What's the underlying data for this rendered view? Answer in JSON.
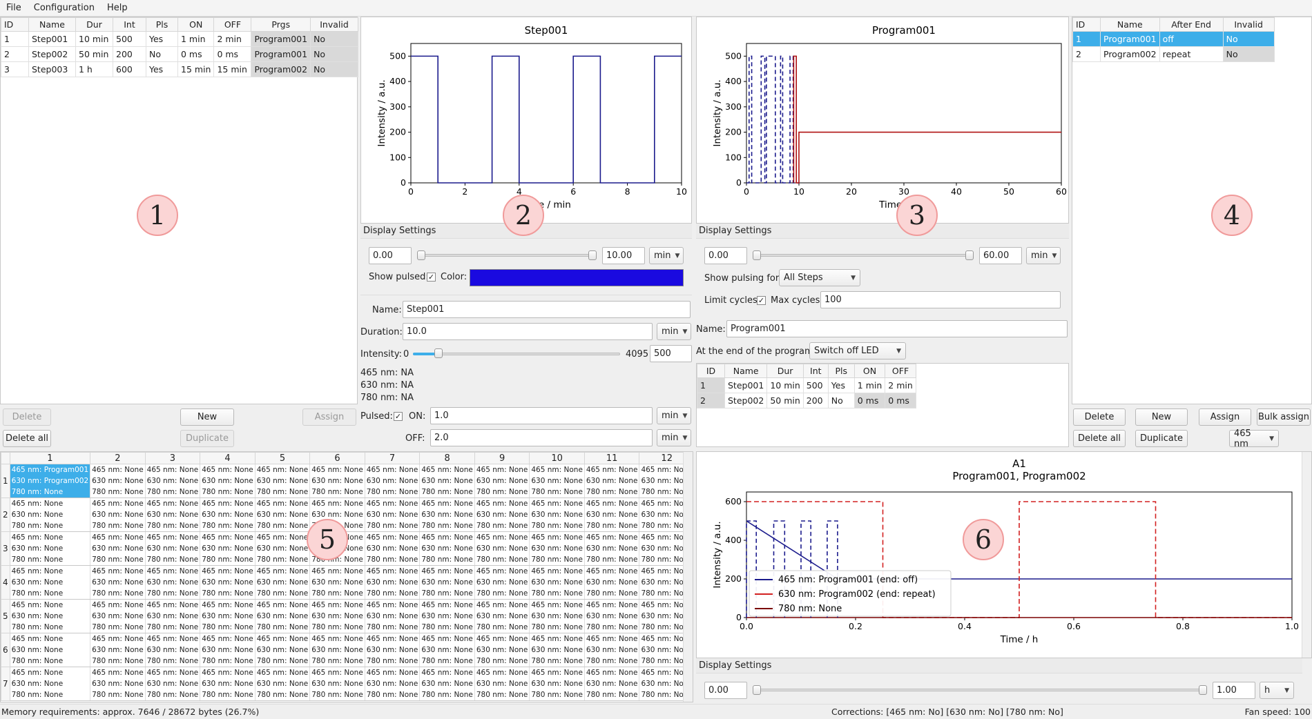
{
  "menu": [
    "File",
    "Configuration",
    "Help"
  ],
  "steps_table": {
    "headers": [
      "ID",
      "Name",
      "Dur",
      "Int",
      "Pls",
      "ON",
      "OFF",
      "Prgs",
      "Invalid"
    ],
    "rows": [
      [
        "1",
        "Step001",
        "10 min",
        "500",
        "Yes",
        "1 min",
        "2 min",
        "Program001",
        "No"
      ],
      [
        "2",
        "Step002",
        "50 min",
        "200",
        "No",
        "0 ms",
        "0 ms",
        "Program001",
        "No"
      ],
      [
        "3",
        "Step003",
        "1 h",
        "600",
        "Yes",
        "15 min",
        "15 min",
        "Program002",
        "No"
      ]
    ],
    "buttons": {
      "delete": "Delete",
      "new": "New",
      "assign": "Assign",
      "delete_all": "Delete all",
      "duplicate": "Duplicate"
    }
  },
  "programs_table": {
    "headers": [
      "ID",
      "Name",
      "After End",
      "Invalid"
    ],
    "rows": [
      [
        "1",
        "Program001",
        "off",
        "No"
      ],
      [
        "2",
        "Program002",
        "repeat",
        "No"
      ]
    ],
    "buttons": {
      "delete": "Delete",
      "new": "New",
      "assign": "Assign",
      "bulk_assign": "Bulk assign",
      "delete_all": "Delete all",
      "duplicate": "Duplicate",
      "wavelength": "465 nm"
    }
  },
  "step_panel": {
    "display_settings": "Display Settings",
    "range_min": "0.00",
    "range_max": "10.00",
    "unit": "min",
    "show_pulsed": "Show pulsed:",
    "color_label": "Color:",
    "color": "#1a0ae0",
    "name_label": "Name:",
    "name": "Step001",
    "duration_label": "Duration:",
    "duration": "10.0",
    "duration_unit": "min",
    "intensity_label": "Intensity:",
    "int_min": "0",
    "int_max": "4095",
    "intensity": "500",
    "intensity_fraction": 0.122,
    "nm465": "465 nm: NA",
    "nm630": "630 nm: NA",
    "nm780": "780 nm: NA",
    "pulsed_label": "Pulsed:",
    "on_label": "ON:",
    "on": "1.0",
    "on_unit": "min",
    "off_label": "OFF:",
    "off": "2.0",
    "off_unit": "min"
  },
  "program_panel": {
    "display_settings": "Display Settings",
    "range_min": "0.00",
    "range_max": "60.00",
    "unit": "min",
    "show_pulsing_label": "Show pulsing for:",
    "show_pulsing": "All Steps",
    "limit_cycles": "Limit cycles:",
    "max_cycles_label": "Max cycles:",
    "max_cycles": "100",
    "name_label": "Name:",
    "name": "Program001",
    "end_label": "At the end of the program:",
    "end_value": "Switch off LED",
    "headers": [
      "ID",
      "Name",
      "Dur",
      "Int",
      "Pls",
      "ON",
      "OFF"
    ],
    "rows": [
      [
        "1",
        "Step001",
        "10 min",
        "500",
        "Yes",
        "1 min",
        "2 min"
      ],
      [
        "2",
        "Step002",
        "50 min",
        "200",
        "No",
        "0 ms",
        "0 ms"
      ]
    ]
  },
  "well_panel": {
    "display_settings": "Display Settings",
    "range_min": "0.00",
    "range_max": "1.00",
    "unit": "h"
  },
  "wells": {
    "columns": [
      "1",
      "2",
      "3",
      "4",
      "5",
      "6",
      "7",
      "8",
      "9",
      "10",
      "11",
      "12"
    ],
    "rows": [
      "1",
      "2",
      "3",
      "4",
      "5",
      "6",
      "7"
    ],
    "selected": [
      "465 nm: Program001",
      "630 nm: Program002",
      "780 nm: None"
    ],
    "default": [
      "465 nm: None",
      "630 nm: None",
      "780 nm: None"
    ]
  },
  "markers": [
    "1",
    "2",
    "3",
    "4",
    "5",
    "6"
  ],
  "status": {
    "memory": "Memory requirements: approx. 7646 / 28672 bytes (26.7%)",
    "corrections": "Corrections: [465 nm: No] [630 nm: No] [780 nm: No]",
    "fan": "Fan speed: 100"
  },
  "chart_data": [
    {
      "type": "line",
      "title": "Step001",
      "xlabel": "Time / min",
      "ylabel": "Intensity / a.u.",
      "xlim": [
        0,
        10
      ],
      "ylim": [
        0,
        550
      ],
      "series": [
        {
          "x": [
            0,
            1,
            1,
            3,
            3,
            4,
            4,
            6,
            6,
            7,
            7,
            9,
            9,
            10
          ],
          "y": [
            500,
            500,
            0,
            0,
            500,
            500,
            0,
            0,
            500,
            500,
            0,
            0,
            500,
            500
          ]
        }
      ]
    },
    {
      "type": "line",
      "title": "Program001",
      "xlabel": "Time / min",
      "ylabel": "Intensity / a.u.",
      "xlim": [
        0,
        60
      ],
      "ylim": [
        0,
        550
      ],
      "series": [
        {
          "style": "dashed",
          "x": [
            0,
            0.5,
            0.5,
            1,
            1,
            2.8,
            2.8,
            3.5,
            3.5,
            3.8,
            3.8,
            5.5,
            5.5,
            6.5,
            6.5,
            6.9,
            6.9,
            8.3,
            8.3,
            8.9,
            8.9,
            10
          ],
          "y": [
            0,
            0,
            500,
            500,
            0,
            0,
            500,
            500,
            0,
            0,
            500,
            500,
            0,
            0,
            500,
            500,
            0,
            0,
            500,
            500,
            0,
            0
          ]
        },
        {
          "x": [
            9,
            9,
            9.5,
            9.5,
            10,
            10,
            60
          ],
          "y": [
            0,
            500,
            500,
            0,
            0,
            200,
            200
          ]
        }
      ]
    },
    {
      "type": "line",
      "title": "A1\nProgram001, Program002",
      "xlabel": "Time / h",
      "ylabel": "Intensity / a.u.",
      "xlim": [
        0,
        1
      ],
      "ylim": [
        0,
        650
      ],
      "legend": [
        "465 nm: Program001 (end: off)",
        "630 nm: Program002 (end: repeat)",
        "780 nm: None"
      ],
      "series": [
        {
          "name": "465 nm: Program001 (end: off)",
          "x": [
            0,
            0.167,
            1
          ],
          "y": [
            500,
            200,
            200
          ]
        },
        {
          "name": "630 nm: Program002 (end: repeat)",
          "x": [
            0,
            0.25,
            0.25,
            0.5,
            0.5,
            0.75,
            0.75,
            1
          ],
          "y": [
            600,
            600,
            0,
            0,
            600,
            600,
            0,
            0
          ]
        },
        {
          "name": "780 nm: None",
          "x": [
            0,
            1
          ],
          "y": [
            0,
            0
          ]
        }
      ]
    }
  ]
}
